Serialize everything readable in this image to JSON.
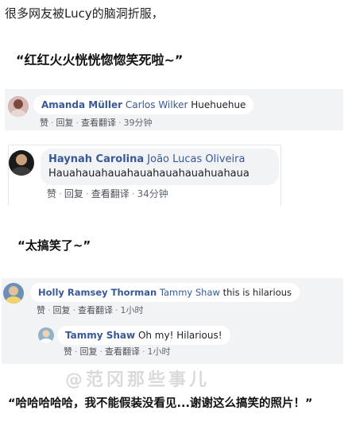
{
  "intro_text": "很多网友被Lucy的脑洞折服，",
  "quotes": [
    "“红红火火恍恍惚惚笑死啦~”",
    "“太搞笑了~”",
    "“哈哈哈哈哈，我不能假装没看见...谢谢这么搞笑的照片！”"
  ],
  "actions": {
    "like": "赞",
    "reply": "回复",
    "translate": "查看翻译"
  },
  "comments": [
    {
      "author": "Amanda Müller",
      "mention": "Carlos Wilker",
      "text": " Huehuehue",
      "time": "39分钟"
    },
    {
      "author": "Haynah Carolina",
      "mention": "João Lucas Oliveira",
      "text": "Hauahauahauahauahauahauahuahaua",
      "time": "34分钟"
    },
    {
      "author": "Holly Ramsey Thorman",
      "mention": "Tammy Shaw",
      "text": " this is hilarious",
      "time": "1小时"
    },
    {
      "author": "Tammy Shaw",
      "mention": "",
      "text": " Oh my! Hilarious!",
      "time": "1小时"
    }
  ],
  "watermark": "@范冈那些事儿",
  "colors": {
    "name": "#385898",
    "bubble": "#f2f3f5",
    "action": "#606770"
  }
}
